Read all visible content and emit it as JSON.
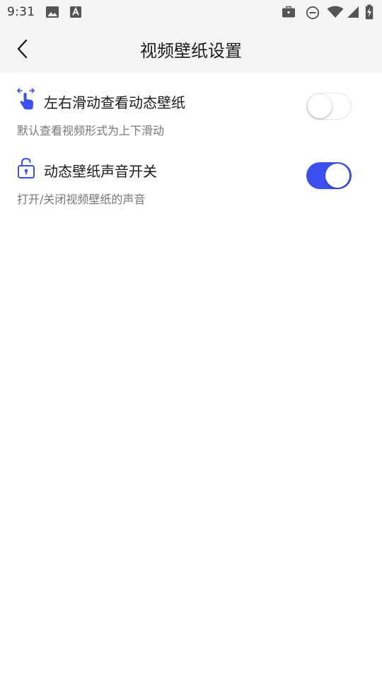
{
  "status_bar": {
    "time": "9:31",
    "left_icons": [
      "image-icon",
      "keyboard-a-icon"
    ],
    "right_icons": [
      "briefcase-icon",
      "do-not-disturb-icon",
      "wifi-icon",
      "signal-icon",
      "battery-charging-icon"
    ]
  },
  "header": {
    "title": "视频壁纸设置",
    "back_icon": "chevron-left-icon"
  },
  "settings": [
    {
      "title": "左右滑动查看动态壁纸",
      "description": "默认查看视频形式为上下滑动",
      "icon": "swipe-hand-icon",
      "enabled": false
    },
    {
      "title": "动态壁纸声音开关",
      "description": "打开/关闭视频壁纸的声音",
      "icon": "unlock-icon",
      "enabled": true
    }
  ],
  "colors": {
    "accent": "#3c50f0",
    "header_bg": "#f5f5f5",
    "description_text": "#777777"
  }
}
